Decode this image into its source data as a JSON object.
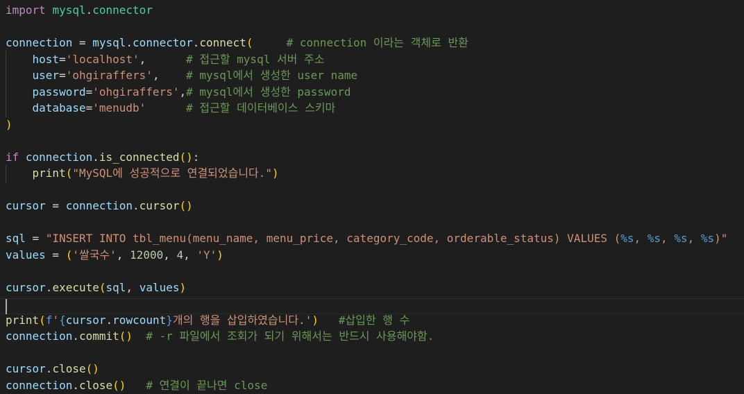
{
  "editor": {
    "lines": [
      [
        [
          "kw",
          "import"
        ],
        [
          "op",
          " "
        ],
        [
          "mod",
          "mysql"
        ],
        [
          "op",
          "."
        ],
        [
          "mod",
          "connector"
        ]
      ],
      [],
      [
        [
          "var",
          "connection"
        ],
        [
          "op",
          " = "
        ],
        [
          "var",
          "mysql"
        ],
        [
          "op",
          "."
        ],
        [
          "var",
          "connector"
        ],
        [
          "op",
          "."
        ],
        [
          "fn",
          "connect"
        ],
        [
          "br1",
          "("
        ],
        [
          "op",
          "     "
        ],
        [
          "cm",
          "# connection 이라는 객체로 반환"
        ]
      ],
      [
        [
          "op",
          "    "
        ],
        [
          "var",
          "host"
        ],
        [
          "op",
          "="
        ],
        [
          "str",
          "'localhost'"
        ],
        [
          "op",
          ",      "
        ],
        [
          "cm",
          "# 접근할 mysql 서버 주소"
        ]
      ],
      [
        [
          "op",
          "    "
        ],
        [
          "var",
          "user"
        ],
        [
          "op",
          "="
        ],
        [
          "str",
          "'ohgiraffers'"
        ],
        [
          "op",
          ",    "
        ],
        [
          "cm",
          "# mysql에서 생성한 user name"
        ]
      ],
      [
        [
          "op",
          "    "
        ],
        [
          "var",
          "password"
        ],
        [
          "op",
          "="
        ],
        [
          "str",
          "'ohgiraffers'"
        ],
        [
          "op",
          ","
        ],
        [
          "cm",
          "# mysql에서 생성한 password"
        ]
      ],
      [
        [
          "op",
          "    "
        ],
        [
          "var",
          "database"
        ],
        [
          "op",
          "="
        ],
        [
          "str",
          "'menudb'"
        ],
        [
          "op",
          "      "
        ],
        [
          "cm",
          "# 접근할 데이터베이스 스키마"
        ]
      ],
      [
        [
          "br1",
          ")"
        ]
      ],
      [],
      [
        [
          "kw",
          "if"
        ],
        [
          "op",
          " "
        ],
        [
          "var",
          "connection"
        ],
        [
          "op",
          "."
        ],
        [
          "fn",
          "is_connected"
        ],
        [
          "br1",
          "()"
        ],
        [
          "op",
          ":"
        ]
      ],
      [
        [
          "op",
          "    "
        ],
        [
          "fn",
          "print"
        ],
        [
          "br1",
          "("
        ],
        [
          "str",
          "\"MySQL에 성공적으로 연결되었습니다.\""
        ],
        [
          "br1",
          ")"
        ]
      ],
      [],
      [
        [
          "var",
          "cursor"
        ],
        [
          "op",
          " = "
        ],
        [
          "var",
          "connection"
        ],
        [
          "op",
          "."
        ],
        [
          "fn",
          "cursor"
        ],
        [
          "br1",
          "()"
        ]
      ],
      [],
      [
        [
          "var",
          "sql"
        ],
        [
          "op",
          " = "
        ],
        [
          "str",
          "\"INSERT INTO tbl_menu(menu_name, menu_price, category_code, orderable_status) VALUES ("
        ],
        [
          "fmt",
          "%s"
        ],
        [
          "str",
          ", "
        ],
        [
          "fmt",
          "%s"
        ],
        [
          "str",
          ", "
        ],
        [
          "fmt",
          "%s"
        ],
        [
          "str",
          ", "
        ],
        [
          "fmt",
          "%s"
        ],
        [
          "str",
          ")\""
        ]
      ],
      [
        [
          "var",
          "values"
        ],
        [
          "op",
          " = "
        ],
        [
          "br1",
          "("
        ],
        [
          "str",
          "'쌀국수'"
        ],
        [
          "op",
          ", "
        ],
        [
          "num",
          "12000"
        ],
        [
          "op",
          ", "
        ],
        [
          "num",
          "4"
        ],
        [
          "op",
          ", "
        ],
        [
          "str",
          "'Y'"
        ],
        [
          "br1",
          ")"
        ]
      ],
      [],
      [
        [
          "var",
          "cursor"
        ],
        [
          "op",
          "."
        ],
        [
          "fn",
          "execute"
        ],
        [
          "br1",
          "("
        ],
        [
          "var",
          "sql"
        ],
        [
          "op",
          ", "
        ],
        [
          "var",
          "values"
        ],
        [
          "br1",
          ")"
        ]
      ],
      [],
      [
        [
          "fn",
          "print"
        ],
        [
          "br1",
          "("
        ],
        [
          "fmt",
          "f"
        ],
        [
          "str",
          "'"
        ],
        [
          "fmt",
          "{"
        ],
        [
          "var",
          "cursor"
        ],
        [
          "op",
          "."
        ],
        [
          "var",
          "rowcount"
        ],
        [
          "fmt",
          "}"
        ],
        [
          "str",
          "개의 행을 삽입하였습니다.'"
        ],
        [
          "br1",
          ")"
        ],
        [
          "op",
          "   "
        ],
        [
          "cm",
          "#삽입한 행 수"
        ]
      ],
      [
        [
          "var",
          "connection"
        ],
        [
          "op",
          "."
        ],
        [
          "fn",
          "commit"
        ],
        [
          "br1",
          "()"
        ],
        [
          "op",
          "  "
        ],
        [
          "cm",
          "# -r 파일에서 조회가 되기 위해서는 반드시 사용해야함."
        ]
      ],
      [],
      [
        [
          "var",
          "cursor"
        ],
        [
          "op",
          "."
        ],
        [
          "fn",
          "close"
        ],
        [
          "br1",
          "()"
        ]
      ],
      [
        [
          "var",
          "connection"
        ],
        [
          "op",
          "."
        ],
        [
          "fn",
          "close"
        ],
        [
          "br1",
          "()"
        ],
        [
          "op",
          "   "
        ],
        [
          "cm",
          "# 연결이 끝나면 close"
        ]
      ]
    ]
  },
  "colors": {
    "background": "#1e1e1e",
    "keyword": "#c586c0",
    "function": "#dcdcaa",
    "variable": "#9cdcfe",
    "string": "#ce9178",
    "comment": "#6a9955",
    "number": "#b5cea8",
    "bracket": "#ffd700"
  }
}
